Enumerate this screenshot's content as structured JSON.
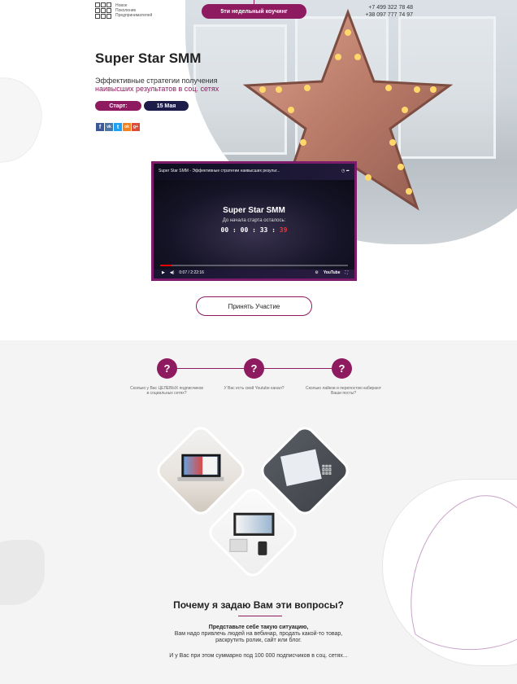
{
  "header": {
    "logo_text": [
      "Новое",
      "Поколение",
      "Предпринимателей"
    ],
    "logo_letters": "МНМ",
    "coach_pill": "5ти недельный коучинг",
    "phones": [
      "+7 499 322 78 48",
      "+38 097 777 74 97"
    ]
  },
  "hero": {
    "title": "Super Star SMM",
    "subtitle_line1": "Эффективные стратегии получения",
    "subtitle_line2": "наивысших результатов в соц. сетях",
    "start_label": "Старт:",
    "start_date": "15 Мая",
    "social_icons": [
      "facebook-icon",
      "vk-icon",
      "twitter-icon",
      "odnoklassniki-icon",
      "google-plus-icon"
    ],
    "social_glyphs": [
      "f",
      "vk",
      "t",
      "ok",
      "g+"
    ],
    "social_colors": [
      "#3b5998",
      "#4a76a8",
      "#1da1f2",
      "#f58220",
      "#dd4b39"
    ]
  },
  "video": {
    "heading": "Super Star SMM - Эффективные стратегии наивысших результ...",
    "title": "Super Star SMM",
    "subtitle": "До начала старта осталось:",
    "timer_main": "00 : 00 : 33 : ",
    "timer_red": "39",
    "time": "0:07 / 2:22:16",
    "progress": 0.06,
    "youtube": "YouTube"
  },
  "cta": {
    "label": "Принять Участие"
  },
  "steps": [
    {
      "icon": "?",
      "text": "Сколько у Вас ЦЕЛЕВЫХ подписчиков в социальных сетях?"
    },
    {
      "icon": "?",
      "text": "У Вас есть свой Youtube канал?"
    },
    {
      "icon": "?",
      "text": "Сколько лайков и перепостов набирают Ваши посты?"
    }
  ],
  "why": {
    "title": "Почему я задаю Вам эти вопросы?",
    "p1_bold": "Представьте себе такую ситуацию,",
    "p1_l2": "Вам надо привлечь людей на вебинар, продать какой-то товар,",
    "p1_l3": "раскрутить ролик, сайт или блог.",
    "p2": "И у Вас при этом суммарно под 100 000 подписчиков в соц. сетях..."
  },
  "colors": {
    "accent": "#8e1a5f",
    "dark_pill": "#1c1b4a",
    "video_border": "#7c1c6b"
  }
}
